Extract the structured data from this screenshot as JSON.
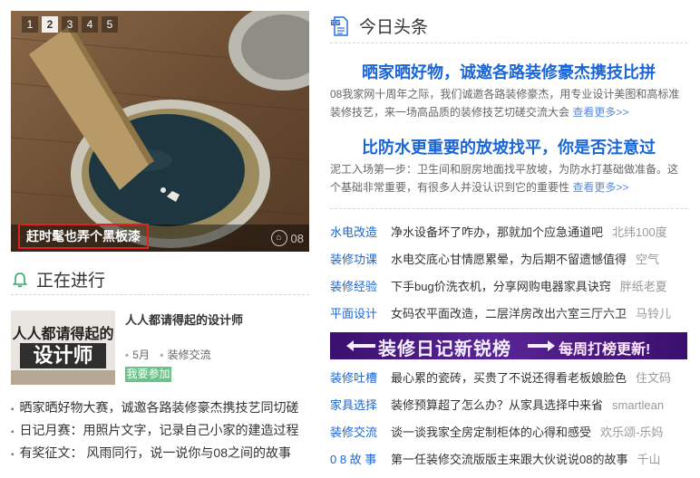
{
  "slider": {
    "dots": [
      "1",
      "2",
      "3",
      "4",
      "5"
    ],
    "active_index": 1,
    "caption": "赶时髦也弄个黑板漆",
    "watermark": "08"
  },
  "ongoing": {
    "title": "正在进行",
    "event": {
      "image_line1": "人人都请得起的",
      "image_line2": "设计师",
      "title": "人人都请得起的设计师",
      "month": "5月",
      "category": "装修交流",
      "join_label": "我要参加"
    },
    "items": [
      "晒家晒好物大赛，诚邀各路装修豪杰携技艺同切磋",
      "日记月赛：用照片文字，记录自己小家的建造过程",
      "有奖征文： 风雨同行，说一说你与08之间的故事"
    ]
  },
  "headlines": {
    "title": "今日头条",
    "items": [
      {
        "title": "晒家晒好物，诚邀各路装修豪杰携技比拼",
        "summary": "08我家网十周年之际，我们诚邀各路装修豪杰，用专业设计美图和高标准装修技艺，来一场高品质的装修技艺切磋交流大会",
        "more": "查看更多>>"
      },
      {
        "title": "比防水更重要的放坡找平，你是否注意过",
        "summary": "泥工入场第一步：卫生间和厨房地面找平放坡，为防水打基础做准备。这个基础非常重要，有很多人并没认识到它的重要性",
        "more": "查看更多>>"
      }
    ]
  },
  "list_top": [
    {
      "category": "水电改造",
      "title": "净水设备坏了咋办，那就加个应急通道吧",
      "author": "北纬100度"
    },
    {
      "category": "装修功课",
      "title": "水电交底心甘情愿累晕，为后期不留遗憾值得",
      "author": "空气"
    },
    {
      "category": "装修经验",
      "title": "下手bug价洗衣机，分享网购电器家具诀窍",
      "author": "胖纸老夏"
    },
    {
      "category": "平面设计",
      "title": "女码农平面改造，二层洋房改出六室三厅六卫",
      "author": "马铃儿"
    }
  ],
  "banner": {
    "left_text": "装修日记新锐榜",
    "right_text": "每周打榜更新!"
  },
  "list_bottom": [
    {
      "category": "装修吐槽",
      "title": "最心累的瓷砖，买贵了不说还得看老板娘脸色",
      "author": "住文码"
    },
    {
      "category": "家具选择",
      "title": "装修预算超了怎么办？从家具选择中来省",
      "author": "smartlean"
    },
    {
      "category": "装修交流",
      "title": "谈一谈我家全房定制柜体的心得和感受",
      "author": "欢乐颂-乐妈"
    },
    {
      "category": "0 8 故 事",
      "title": "第一任装修交流版版主来跟大伙说说08的故事",
      "author": "千山"
    }
  ],
  "colors": {
    "accent_blue": "#1a66d6",
    "green": "#6dc28a",
    "highlight_red": "#e3201f",
    "banner_purple": "#45187a"
  }
}
